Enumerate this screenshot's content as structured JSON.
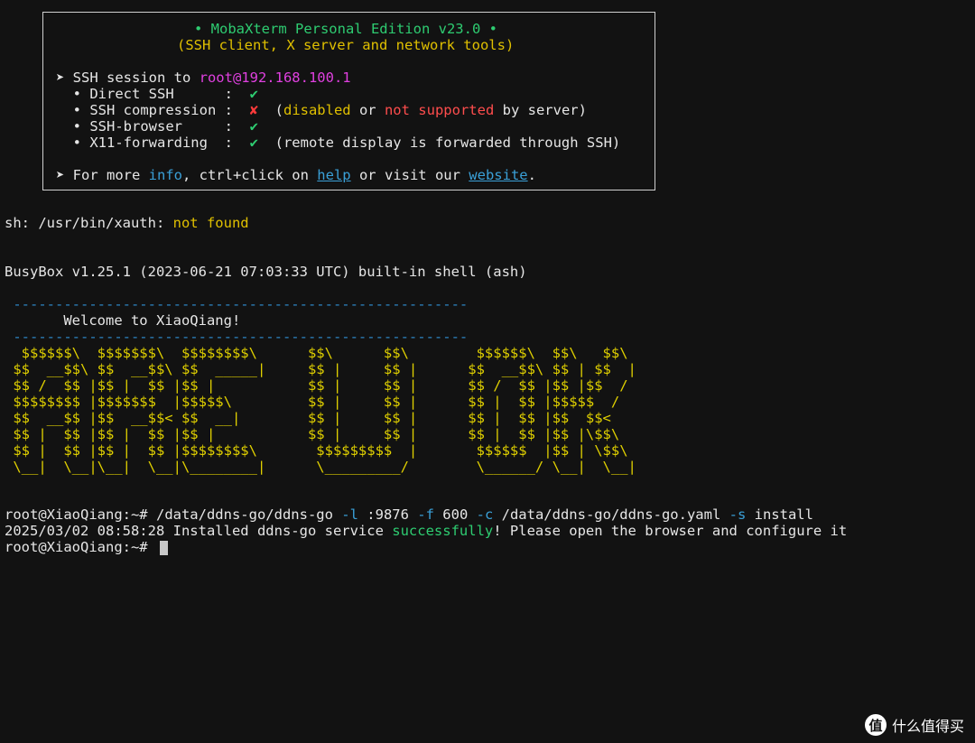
{
  "banner": {
    "title": "• MobaXterm Personal Edition v23.0 •",
    "subtitle": "(SSH client, X server and network tools)",
    "session_prefix": "➤ SSH session to ",
    "session_target": "root@192.168.100.1",
    "direct_ssh_label": "  • Direct SSH      :  ",
    "check_mark": "✔",
    "cross_mark": "✘",
    "compression_label": "  • SSH compression :  ",
    "compression_open": "  (",
    "disabled_text": "disabled",
    "or_text": " or ",
    "not_supported_text": "not supported",
    "by_server_text": " by server)",
    "browser_label": "  • SSH-browser     :  ",
    "x11_label": "  • X11-forwarding  :  ",
    "x11_note": "  (remote display is forwarded through SSH)",
    "more_prefix": "➤ For more ",
    "info_link": "info",
    "ctrl_text": ", ctrl+click on ",
    "help_link": "help",
    "visit_text": " or visit our ",
    "website_link": "website",
    "period": "."
  },
  "terminal": {
    "xauth_prefix": "sh: /usr/bin/xauth: ",
    "xauth_status": "not found",
    "busybox_line": "BusyBox v1.25.1 (2023-06-21 07:03:33 UTC) built-in shell (ash)",
    "dash_line": " ------------------------------------------------------",
    "welcome_line": "       Welcome to XiaoQiang!",
    "ascii_art": [
      "  $$$$$$\\  $$$$$$$\\  $$$$$$$$\\      $$\\      $$\\        $$$$$$\\  $$\\   $$\\",
      " $$  __$$\\ $$  __$$\\ $$  _____|     $$ |     $$ |      $$  __$$\\ $$ | $$  |",
      " $$ /  $$ |$$ |  $$ |$$ |           $$ |     $$ |      $$ /  $$ |$$ |$$  /",
      " $$$$$$$$ |$$$$$$$  |$$$$$\\         $$ |     $$ |      $$ |  $$ |$$$$$  /",
      " $$  __$$ |$$  __$$< $$  __|        $$ |     $$ |      $$ |  $$ |$$  $$<",
      " $$ |  $$ |$$ |  $$ |$$ |           $$ |     $$ |      $$ |  $$ |$$ |\\$$\\",
      " $$ |  $$ |$$ |  $$ |$$$$$$$$\\       $$$$$$$$$  |       $$$$$$  |$$ | \\$$\\",
      " \\__|  \\__|\\__|  \\__|\\________|      \\_________/        \\______/ \\__|  \\__|"
    ],
    "prompt": "root@XiaoQiang:~# ",
    "cmd_path": "/data/ddns-go/ddns-go ",
    "flag_l": "-l",
    "arg_l": " :9876 ",
    "flag_f": "-f",
    "arg_f": " 600 ",
    "flag_c": "-c",
    "arg_c": " /data/ddns-go/ddns-go.yaml ",
    "flag_s": "-s",
    "arg_s": " install",
    "result_prefix": "2025/03/02 08:58:28 Installed ddns-go service ",
    "result_success": "successfully",
    "result_suffix": "! Please open the browser and configure it"
  },
  "watermark": {
    "icon_char": "值",
    "text": "什么值得买"
  }
}
